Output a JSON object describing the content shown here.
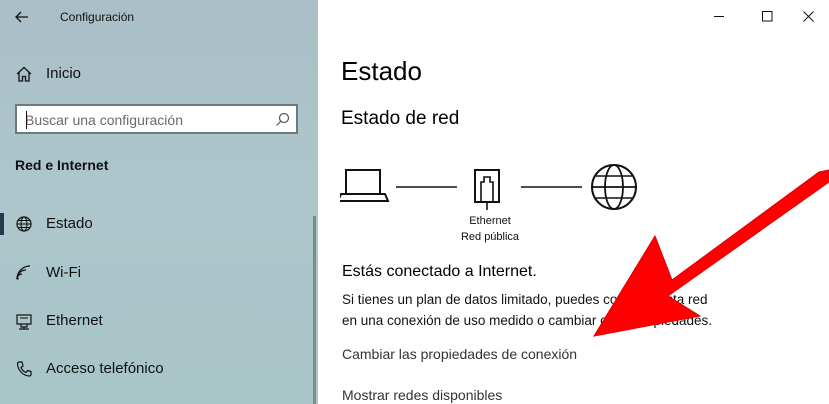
{
  "window": {
    "title": "Configuración"
  },
  "sidebar": {
    "home_label": "Inicio",
    "search": {
      "placeholder": "Buscar una configuración",
      "value": ""
    },
    "section_title": "Red e Internet",
    "items": [
      {
        "label": "Estado",
        "icon": "globe-icon",
        "active": true
      },
      {
        "label": "Wi-Fi",
        "icon": "wifi-icon",
        "active": false
      },
      {
        "label": "Ethernet",
        "icon": "ethernet-icon",
        "active": false
      },
      {
        "label": "Acceso telefónico",
        "icon": "dialup-icon",
        "active": false
      }
    ]
  },
  "main": {
    "page_title": "Estado",
    "section_title": "Estado de red",
    "diagram": {
      "device_caption_line1": "Ethernet",
      "device_caption_line2": "Red pública"
    },
    "status": "Estás conectado a Internet.",
    "description_line1": "Si tienes un plan de datos limitado, puedes convertir esta red",
    "description_line2": "en una conexión de uso medido o cambiar otras propiedades.",
    "links": {
      "change_properties": "Cambiar las propiedades de conexión",
      "show_networks": "Mostrar redes disponibles"
    }
  },
  "colors": {
    "sidebar_bg": "#adc6cc",
    "accent_arrow": "#ff0000",
    "active_indicator": "#243a4a"
  }
}
